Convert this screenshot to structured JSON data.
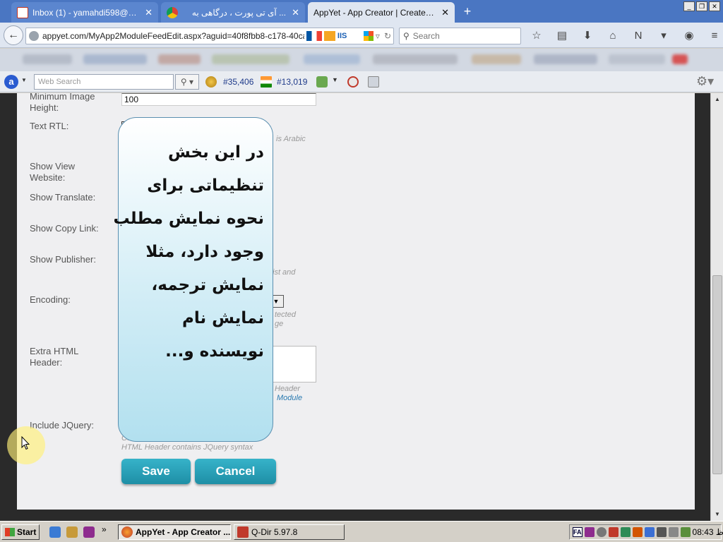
{
  "browser": {
    "tabs": [
      {
        "title": "Inbox (1) - yamahdi598@gma...",
        "active": false
      },
      {
        "title": "... آی تی پورت ، درگاهی به",
        "active": false
      },
      {
        "title": "AppYet - App Creator | Create An...",
        "active": true
      }
    ],
    "new_tab_symbol": "+",
    "url": "appyet.com/MyApp2ModuleFeedEdit.aspx?aguid=40f8fbb8-c178-40ca-8",
    "search_placeholder": "Search"
  },
  "toolbar2": {
    "websearch_placeholder": "Web Search",
    "rank1": "#35,406",
    "rank2": "#13,019"
  },
  "form": {
    "min_image_height_label": "Minimum Image Height:",
    "min_image_height_value": "100",
    "text_rtl_label": "Text RTL:",
    "text_rtl_hint": "is Arabic",
    "show_view_website_label": "Show View Website:",
    "show_translate_label": "Show Translate:",
    "show_copy_link_label": "Show Copy Link:",
    "show_publisher_label": "Show Publisher:",
    "publisher_hint": "ist and",
    "encoding_label": "Encoding:",
    "encoding_hint1": "tected",
    "encoding_hint2": "ge",
    "extra_html_header_label": "Extra HTML Header:",
    "extra_hint1": "Header",
    "extra_hint2": "Module",
    "include_jquery_label": "Include JQuery:",
    "jquery_hint1": "Onl... above Extra",
    "jquery_hint2": "HTML Header contains JQuery syntax",
    "save_label": "Save",
    "cancel_label": "Cancel"
  },
  "overlay": {
    "lines": [
      "در این بخش",
      "تنظیماتی برای",
      "نحوه نمایش مطلب",
      "وجود دارد، مثلا",
      "نمایش ترجمه،",
      "نمایش نام",
      "نویسنده و..."
    ]
  },
  "taskbar": {
    "start_label": "Start",
    "items": [
      {
        "label": "AppYet - App Creator ...",
        "active": true
      },
      {
        "label": "Q-Dir 5.97.8",
        "active": false
      }
    ],
    "lang": "FA",
    "clock": "08:43 ب.ظ"
  }
}
